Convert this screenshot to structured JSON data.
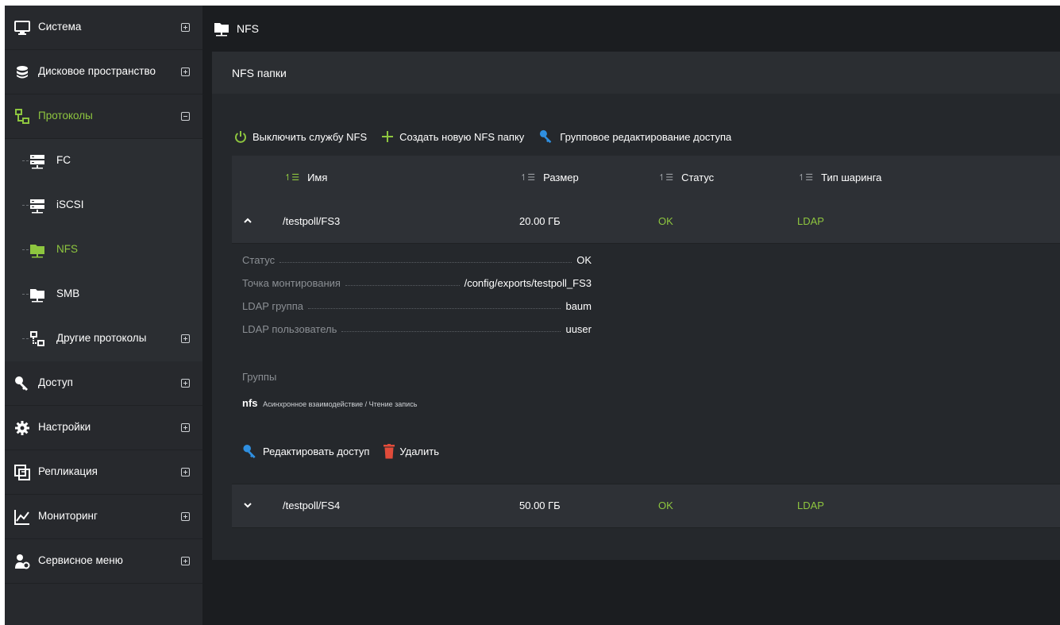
{
  "sidebar": {
    "items": [
      {
        "label": "Система",
        "icon": "monitor-icon"
      },
      {
        "label": "Дисковое пространство",
        "icon": "database-icon"
      },
      {
        "label": "Протоколы",
        "icon": "protocols-icon"
      },
      {
        "label": "Доступ",
        "icon": "key-icon"
      },
      {
        "label": "Настройки",
        "icon": "gear-icon"
      },
      {
        "label": "Репликация",
        "icon": "replication-icon"
      },
      {
        "label": "Мониторинг",
        "icon": "chart-icon"
      },
      {
        "label": "Сервисное меню",
        "icon": "service-icon"
      }
    ],
    "protocol_items": [
      {
        "label": "FC",
        "icon": "server-icon"
      },
      {
        "label": "iSCSI",
        "icon": "server-icon"
      },
      {
        "label": "NFS",
        "icon": "folder-icon"
      },
      {
        "label": "SMB",
        "icon": "folder-icon"
      },
      {
        "label": "Другие протоколы",
        "icon": "protocols-icon"
      }
    ]
  },
  "topbar": {
    "title": "NFS"
  },
  "panel": {
    "title": "NFS папки",
    "actions": {
      "disable": "Выключить службу NFS",
      "create": "Создать новую NFS папку",
      "group_edit": "Групповое редактирование доступа"
    },
    "columns": {
      "name": "Имя",
      "size": "Размер",
      "status": "Статус",
      "share_type": "Тип шаринга"
    },
    "rows": [
      {
        "name": "/testpoll/FS3",
        "size": "20.00 ГБ",
        "status": "OK",
        "share_type": "LDAP",
        "expanded": true
      },
      {
        "name": "/testpoll/FS4",
        "size": "50.00 ГБ",
        "status": "OK",
        "share_type": "LDAP",
        "expanded": false
      }
    ],
    "detail": {
      "status_label": "Статус",
      "status_value": "OK",
      "mount_label": "Точка монтирования",
      "mount_value": "/config/exports/testpoll_FS3",
      "ldap_group_label": "LDAP группа",
      "ldap_group_value": "baum",
      "ldap_user_label": "LDAP пользователь",
      "ldap_user_value": "uuser",
      "groups_label": "Группы",
      "group_name": "nfs",
      "group_desc": "Асинхронное взаимодействие / Чтение запись",
      "edit_access": "Редактировать доступ",
      "delete": "Удалить"
    }
  },
  "colors": {
    "accent_green": "#8ec63f",
    "key_blue": "#2f8fe0",
    "delete_red": "#e04b3a",
    "sidebar_bg": "#27292d",
    "panel_bg": "#25282c"
  }
}
